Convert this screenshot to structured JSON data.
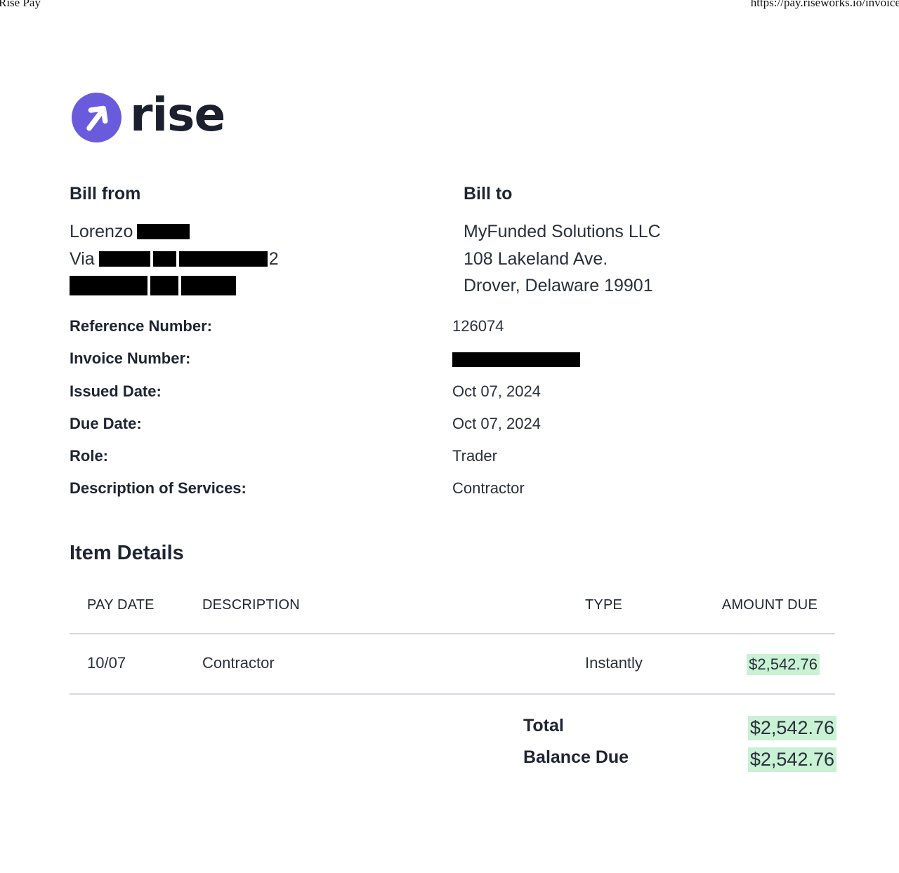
{
  "print_header": {
    "title": "Rise Pay",
    "url": "https://pay.riseworks.io/invoice"
  },
  "logo": {
    "text": "rise"
  },
  "bill_from": {
    "heading": "Bill from",
    "name_visible": "Lorenzo",
    "street_prefix": "Via",
    "street_suffix": "2"
  },
  "bill_to": {
    "heading": "Bill to",
    "lines": [
      "MyFunded Solutions LLC",
      "108 Lakeland Ave.",
      "Drover, Delaware 19901"
    ]
  },
  "meta": [
    {
      "label": "Reference Number:",
      "value": "126074"
    },
    {
      "label": "Invoice Number:",
      "value": ""
    },
    {
      "label": "Issued Date:",
      "value": "Oct 07, 2024"
    },
    {
      "label": "Due Date:",
      "value": "Oct 07, 2024"
    },
    {
      "label": "Role:",
      "value": "Trader"
    },
    {
      "label": "Description of Services:",
      "value": "Contractor"
    }
  ],
  "items": {
    "title": "Item Details",
    "headers": [
      "PAY DATE",
      "DESCRIPTION",
      "TYPE",
      "AMOUNT DUE"
    ],
    "rows": [
      {
        "pay_date": "10/07",
        "description": "Contractor",
        "type": "Instantly",
        "amount": "$2,542.76"
      }
    ]
  },
  "totals": {
    "total_label": "Total",
    "total_value": "$2,542.76",
    "balance_label": "Balance Due",
    "balance_value": "$2,542.76"
  },
  "colors": {
    "brand": "#6a5bdc",
    "highlight": "#c9f1d3",
    "text": "#1f2433",
    "redaction": "#000000"
  }
}
